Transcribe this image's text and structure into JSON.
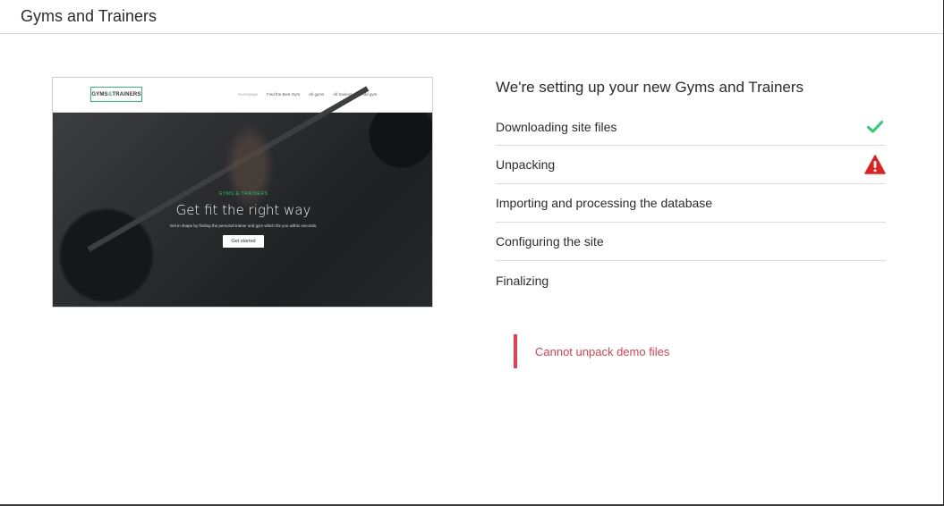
{
  "header": {
    "title": "Gyms and Trainers"
  },
  "preview": {
    "logo_left": "GYMS",
    "logo_amp": "&",
    "logo_right": "TRAINERS",
    "nav": [
      "Homepage",
      "Find the Best Gym",
      "All gyms",
      "All trainers",
      "Add gym"
    ],
    "kicker": "GYMS & TRAINERS",
    "headline": "Get fit the right way",
    "subtext": "Get in shape by finding the personal trainer and gym which fits you within seconds.",
    "cta": "Get started"
  },
  "setup": {
    "heading": "We're setting up your new Gyms and Trainers",
    "steps": [
      {
        "label": "Downloading site files",
        "status": "check-icon"
      },
      {
        "label": "Unpacking",
        "status": "warning-icon"
      },
      {
        "label": "Importing and processing the database",
        "status": ""
      },
      {
        "label": "Configuring the site",
        "status": ""
      },
      {
        "label": "Finalizing",
        "status": ""
      }
    ]
  },
  "error": {
    "message": "Cannot unpack demo files"
  },
  "colors": {
    "success": "#2ecc71",
    "danger": "#e0404f",
    "brand_green": "#2fbf71"
  }
}
